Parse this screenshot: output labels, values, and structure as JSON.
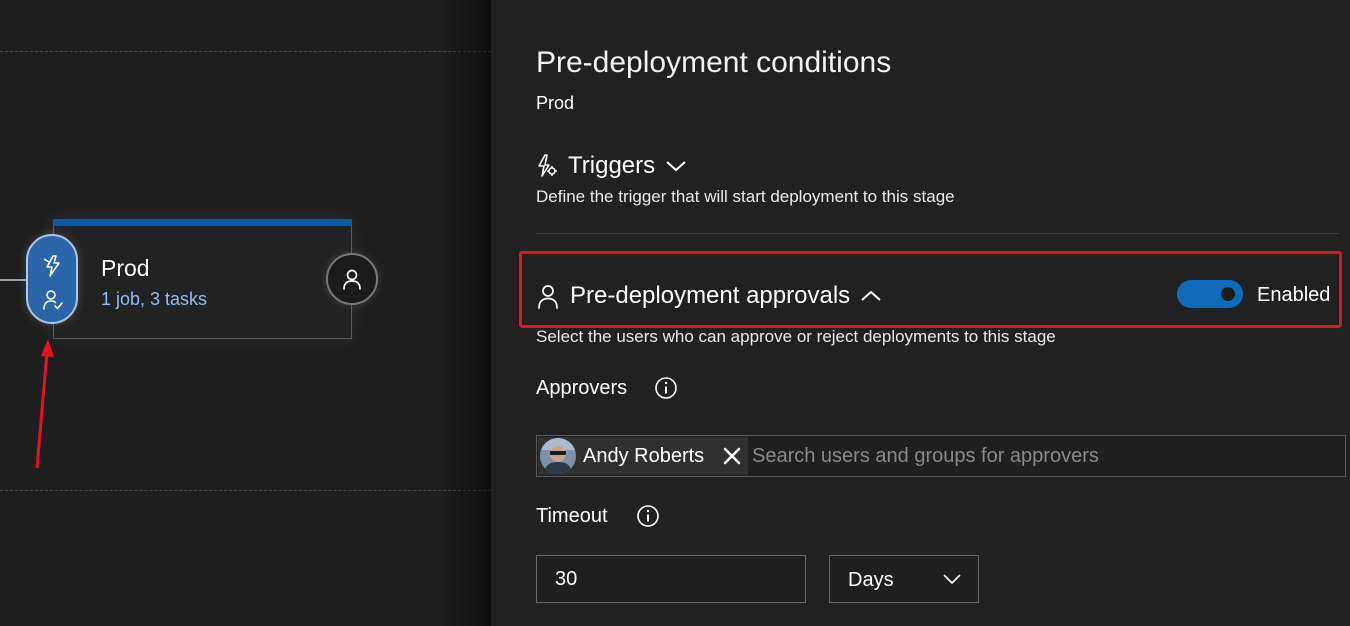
{
  "stage": {
    "name": "Prod",
    "summary": "1 job, 3 tasks"
  },
  "panel": {
    "title": "Pre-deployment conditions",
    "subtitle": "Prod",
    "triggers": {
      "label": "Triggers",
      "description": "Define the trigger that will start deployment to this stage"
    },
    "approvals": {
      "label": "Pre-deployment approvals",
      "toggle_state": "Enabled",
      "description": "Select the users who can approve or reject deployments to this stage",
      "approvers_label": "Approvers",
      "approver_name": "Andy Roberts",
      "search_placeholder": "Search users and groups for approvers",
      "timeout_label": "Timeout",
      "timeout_value": "30",
      "timeout_unit": "Days"
    }
  },
  "colors": {
    "accent": "#0f6cbd",
    "highlight": "#e81123",
    "link": "#8fbff0",
    "annotation_arrow": "#e81123"
  },
  "icons": {
    "trigger": "lightning-gear-icon",
    "approval": "person-icon",
    "info": "info-icon",
    "remove": "close-icon",
    "dropdown": "chevron-down-icon",
    "collapse": "chevron-up-icon"
  }
}
